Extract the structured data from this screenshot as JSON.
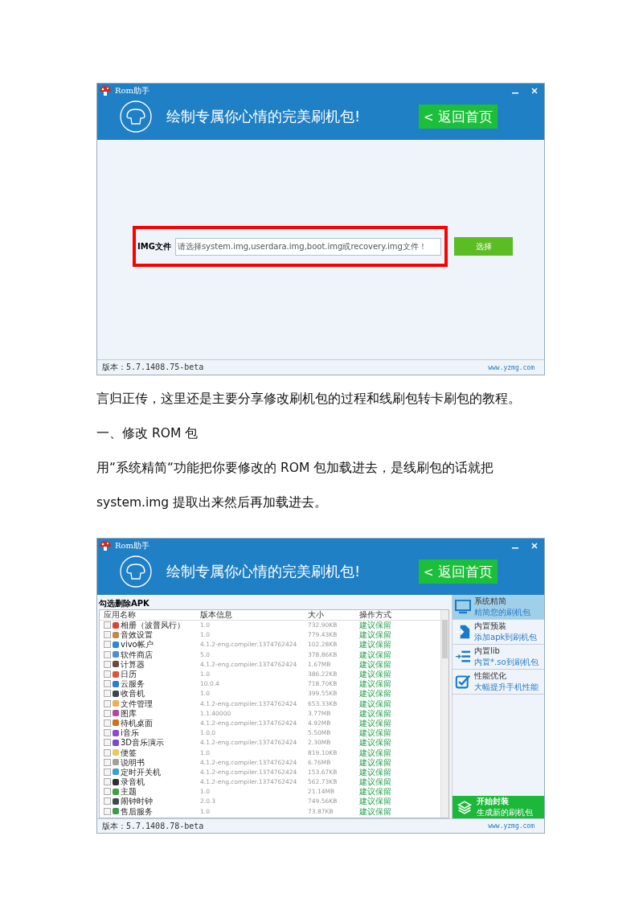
{
  "window_1": {
    "title": "Rom助手",
    "banner": "绘制专属你心情的完美刷机包!",
    "back_button": "返回首页",
    "back_icon": "<",
    "field_label": "IMG文件",
    "field_placeholder": "请选择system.img,userdara.img,boot.img或recovery.img文件！",
    "choose_button": "选择",
    "version": "版本：5.7.1408.75-beta",
    "website": "www.yzmg.com"
  },
  "paragraphs": [
    "言归正传，这里还是主要分享修改刷机包的过程和线刷包转卡刷包的教程。",
    "一、修改 ROM 包",
    "用“系统精简“功能把你要修改的 ROM 包加载进去，是线刷包的话就把",
    "system.img 提取出来然后再加载进去。"
  ],
  "window_2": {
    "title": "Rom助手",
    "banner": "绘制专属你心情的完美刷机包!",
    "back_button": "返回首页",
    "back_icon": "<",
    "section_title": "勾选删除APK",
    "columns": [
      "应用名称",
      "版本信息",
      "大小",
      "操作方式"
    ],
    "rows": [
      {
        "name": "相册（波普风行）",
        "version": "1.0",
        "size": "732.90KB",
        "action": "建议保留",
        "checked": false,
        "color": "#d9443a"
      },
      {
        "name": "音效设置",
        "version": "1.0",
        "size": "779.43KB",
        "action": "建议保留",
        "checked": false,
        "color": "#c08a4a"
      },
      {
        "name": "vivo帐户",
        "version": "4.1.2-eng.compiler.1374762424",
        "size": "102.28KB",
        "action": "建议保留",
        "checked": false,
        "color": "#2a8ad6"
      },
      {
        "name": "软件商店",
        "version": "5.0",
        "size": "378.86KB",
        "action": "建议保留",
        "checked": false,
        "color": "#4a90d0"
      },
      {
        "name": "计算器",
        "version": "4.1.2-eng.compiler.1374762424",
        "size": "1.67MB",
        "action": "建议保留",
        "checked": false,
        "color": "#6a4a3a"
      },
      {
        "name": "日历",
        "version": "1.0",
        "size": "386.22KB",
        "action": "建议保留",
        "checked": false,
        "color": "#e0503a"
      },
      {
        "name": "云服务",
        "version": "10.0.4",
        "size": "718.70KB",
        "action": "建议保留",
        "checked": false,
        "color": "#2a7ed0"
      },
      {
        "name": "收音机",
        "version": "1.0",
        "size": "399.55KB",
        "action": "建议保留",
        "checked": false,
        "color": "#3a4450"
      },
      {
        "name": "文件管理",
        "version": "4.1.2-eng.compiler.1374762424",
        "size": "653.33KB",
        "action": "建议保留",
        "checked": false,
        "color": "#e8b050"
      },
      {
        "name": "图库",
        "version": "1.1.40000",
        "size": "3.77MB",
        "action": "建议保留",
        "checked": false,
        "color": "#b04aa0"
      },
      {
        "name": "待机桌面",
        "version": "4.1.2-eng.compiler.1374762424",
        "size": "4.92MB",
        "action": "建议保留",
        "checked": false,
        "color": "#d0701a"
      },
      {
        "name": "i音乐",
        "version": "1.0.0",
        "size": "5.50MB",
        "action": "建议保留",
        "checked": false,
        "color": "#8a4ad0"
      },
      {
        "name": "3D音乐演示",
        "version": "4.1.2-eng.compiler.1374762424",
        "size": "2.30MB",
        "action": "建议保留",
        "checked": false,
        "color": "#7a4ac8"
      },
      {
        "name": "便签",
        "version": "1.0",
        "size": "819.10KB",
        "action": "建议保留",
        "checked": false,
        "color": "#e8c860"
      },
      {
        "name": "说明书",
        "version": "4.1.2-eng.compiler.1374762424",
        "size": "6.76MB",
        "action": "建议保留",
        "checked": false,
        "color": "#a0a0a0"
      },
      {
        "name": "定时开关机",
        "version": "4.1.2-eng.compiler.1374762424",
        "size": "153.67KB",
        "action": "建议保留",
        "checked": false,
        "color": "#3aa0d8"
      },
      {
        "name": "录音机",
        "version": "4.1.2-eng.compiler.1374762424",
        "size": "562.73KB",
        "action": "建议保留",
        "checked": false,
        "color": "#303030"
      },
      {
        "name": "主题",
        "version": "1.0",
        "size": "21.14MB",
        "action": "建议保留",
        "checked": false,
        "color": "#40a040"
      },
      {
        "name": "闹钟时钟",
        "version": "2.0.3",
        "size": "749.56KB",
        "action": "建议保留",
        "checked": false,
        "color": "#404850"
      },
      {
        "name": "售后服务",
        "version": "1.0",
        "size": "73.87KB",
        "action": "建议保留",
        "checked": false,
        "color": "#3a9a50"
      }
    ],
    "tools": [
      {
        "kind": "monitor",
        "title": "系统精简",
        "subtitle": "精简您的刷机包",
        "selected": true
      },
      {
        "kind": "import",
        "title": "内置预装",
        "subtitle": "添加apk到刷机包",
        "selected": false
      },
      {
        "kind": "list",
        "title": "内置lib",
        "subtitle": "内置*.so到刷机包",
        "selected": false
      },
      {
        "kind": "check",
        "title": "性能优化",
        "subtitle": "大幅提升手机性能",
        "selected": false
      }
    ],
    "pack_button": {
      "title": "开始封装",
      "subtitle": "生成新的刷机包"
    },
    "version": "版本：5.7.1408.78-beta",
    "website": "www.yzmg.com"
  }
}
